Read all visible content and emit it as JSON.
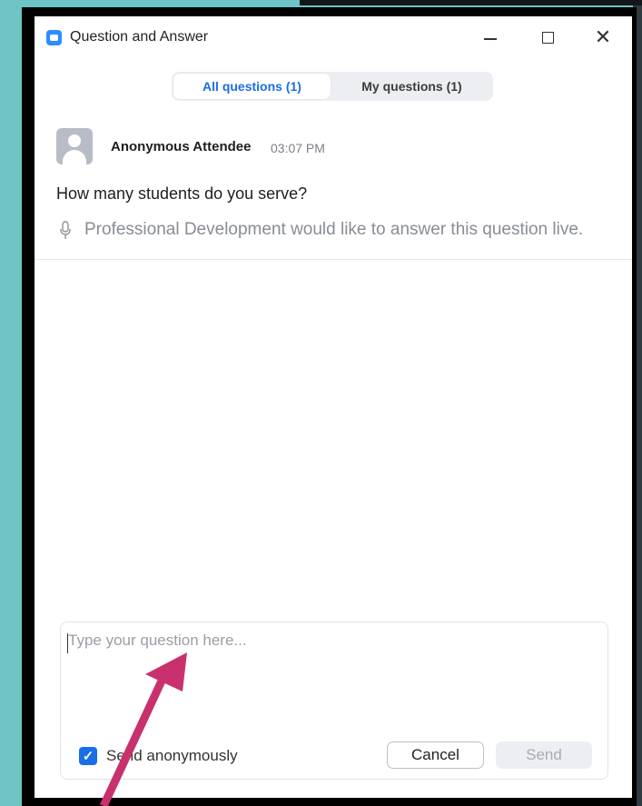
{
  "window": {
    "title": "Question and Answer",
    "minimize_glyph": "",
    "close_glyph": "✕",
    "accent_color": "#1a6ee8"
  },
  "tabs": [
    {
      "label": "All questions (1)",
      "selected": true
    },
    {
      "label": "My questions (1)",
      "selected": false
    }
  ],
  "question": {
    "author": "Anonymous Attendee",
    "time": "03:07 PM",
    "text": "How many students do you serve?",
    "status": "Professional Development would like to answer this question live.",
    "avatar_icon": "user-avatar-icon",
    "status_icon": "microphone-icon"
  },
  "composer": {
    "value": "",
    "placeholder": "Type your question here...",
    "anonymous_label": "Send anonymously",
    "anonymous_checked": true,
    "cancel_label": "Cancel",
    "send_label": "Send"
  },
  "annotation": {
    "arrow_color": "#c8316d"
  }
}
